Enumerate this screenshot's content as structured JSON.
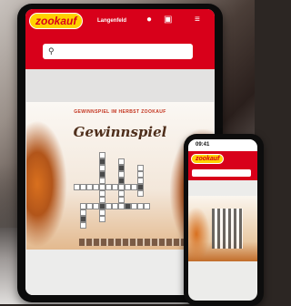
{
  "tablet": {
    "logo": "zookauf",
    "nav_location": "Langenfeld",
    "icons": [
      "user-icon",
      "cart-icon",
      "menu-icon"
    ],
    "search_icon": "search-icon",
    "promo": {
      "top_text": "GEWINNSPIEL IM HERBST ZOOKAUF",
      "title": "Gewinnspiel"
    }
  },
  "phone": {
    "time": "09:41",
    "logo": "zookauf"
  },
  "colors": {
    "brand_red": "#d8001a",
    "brand_yellow": "#ffd200"
  }
}
